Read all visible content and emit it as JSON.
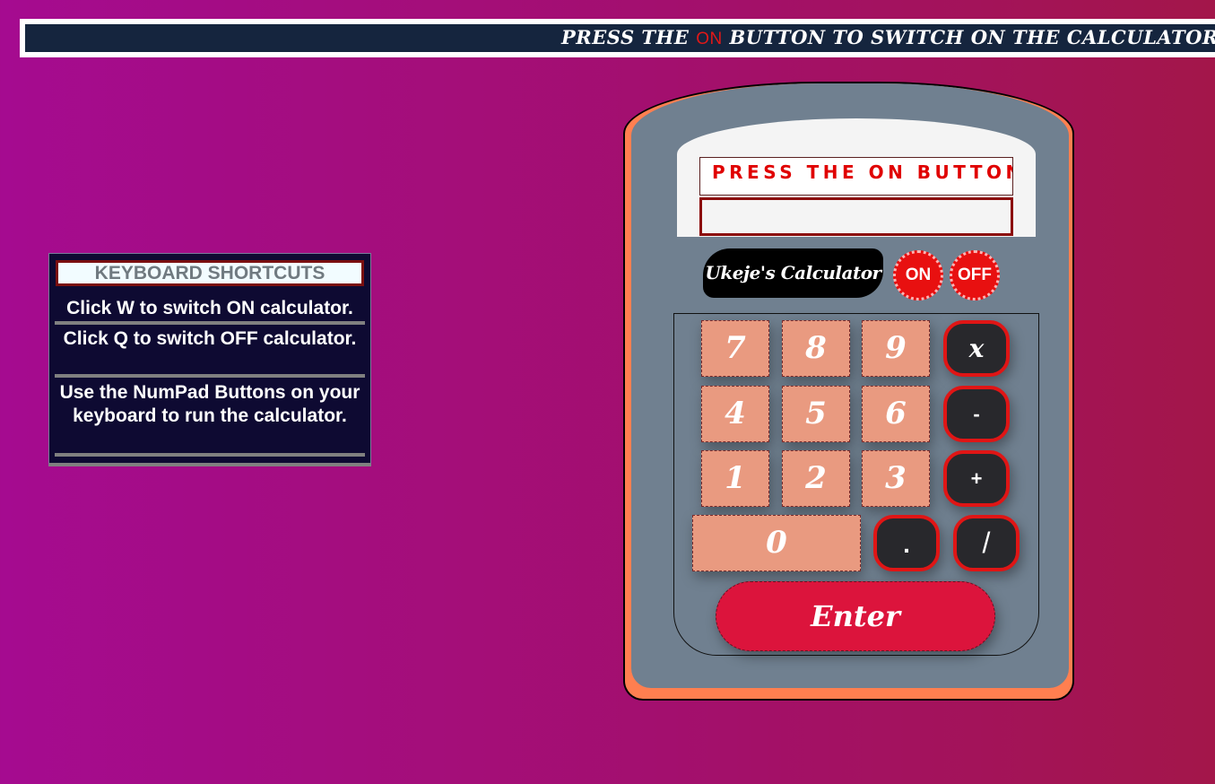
{
  "banner": {
    "prefix": "PRESS THE ",
    "on_word": "ON",
    "suffix": " BUTTON TO SWITCH ON THE CALCULATOR!"
  },
  "shortcuts": {
    "title": "KEYBOARD SHORTCUTS",
    "items": [
      "Click W to switch ON calculator.",
      "Click Q to switch OFF calculator.",
      "Use the NumPad Buttons on your keyboard to run the calculator."
    ]
  },
  "calculator": {
    "display_message": "PRESS THE ON BUTTON",
    "display_value": "",
    "brand": "Ukeje's Calculator",
    "on_label": "ON",
    "off_label": "OFF",
    "keys": {
      "k7": "7",
      "k8": "8",
      "k9": "9",
      "k4": "4",
      "k5": "5",
      "k6": "6",
      "k1": "1",
      "k2": "2",
      "k3": "3",
      "k0": "0"
    },
    "ops": {
      "multiply": "x",
      "subtract": "-",
      "add": "+",
      "decimal": ".",
      "divide": "/"
    },
    "enter_label": "Enter"
  },
  "colors": {
    "accent_red": "#e01515",
    "body_orange": "#ff7f50",
    "body_slate": "#708090",
    "key_salmon": "#e99a80",
    "enter_crimson": "#dc143c"
  }
}
